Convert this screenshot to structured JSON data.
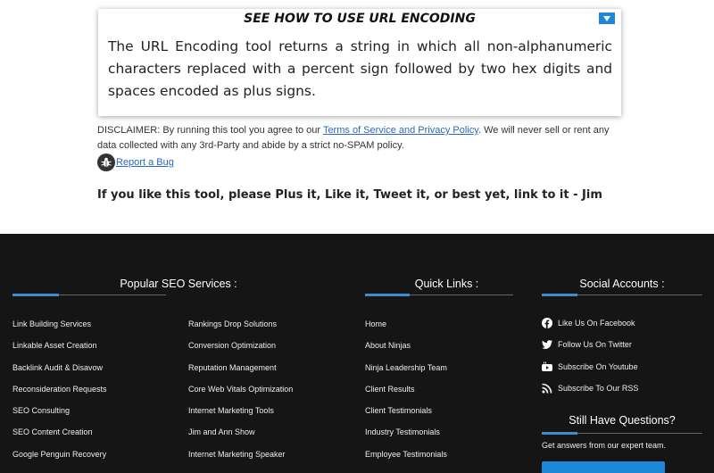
{
  "how_to": {
    "title": "SEE HOW TO USE URL ENCODING",
    "body": "The URL Encoding tool returns a string in which all non-alphanumeric characters replaced with a percent sign followed by two hex digits and spaces encoded as plus signs."
  },
  "disclaimer": {
    "prefix": "DISCLAIMER: By running this tool you agree to our ",
    "link": "Terms of Service and Privacy Policy",
    "suffix": ". We will never sell or rent any data collected with any 3rd-Party and abide by a strict no-SPAM policy."
  },
  "report_bug": "Report a Bug",
  "plus_line": "If you like this tool, please Plus it, Like it, Tweet it, or best yet, link to it - Jim",
  "footer": {
    "seo": {
      "heading": "Popular SEO Services :",
      "col1": [
        "Link Building Services",
        "Linkable Asset Creation",
        "Backlink Audit & Disavow",
        "Reconsideration Requests",
        "SEO Consulting",
        "SEO Content Creation",
        "Google Penguin Recovery"
      ],
      "col2": [
        "Rankings Drop Solutions",
        "Conversion Optimization",
        "Reputation Management",
        "Core Web Vitals Optimization",
        "Internet Marketing Tools",
        "Jim and Ann Show",
        "Internet Marketing Speaker"
      ]
    },
    "quick": {
      "heading": "Quick Links :",
      "items": [
        "Home",
        "About Ninjas",
        "Ninja Leadership Team",
        "Client Results",
        "Client Testimonials",
        "Industry Testimonials",
        "Employee Testimonials"
      ]
    },
    "social": {
      "heading": "Social Accounts :",
      "items": [
        {
          "label": "Like Us On Facebook",
          "icon": "facebook-icon"
        },
        {
          "label": "Follow Us On Twitter",
          "icon": "twitter-icon"
        },
        {
          "label": "Subscribe On Youtube",
          "icon": "youtube-icon"
        },
        {
          "label": "Subscribe To Our RSS",
          "icon": "rss-icon"
        }
      ]
    },
    "questions": {
      "heading": "Still Have Questions?",
      "text": "Get answers from our expert team."
    }
  },
  "colors": {
    "accent": "#1e88d8",
    "footer_bg": "#151515",
    "link": "#2a68c8"
  }
}
